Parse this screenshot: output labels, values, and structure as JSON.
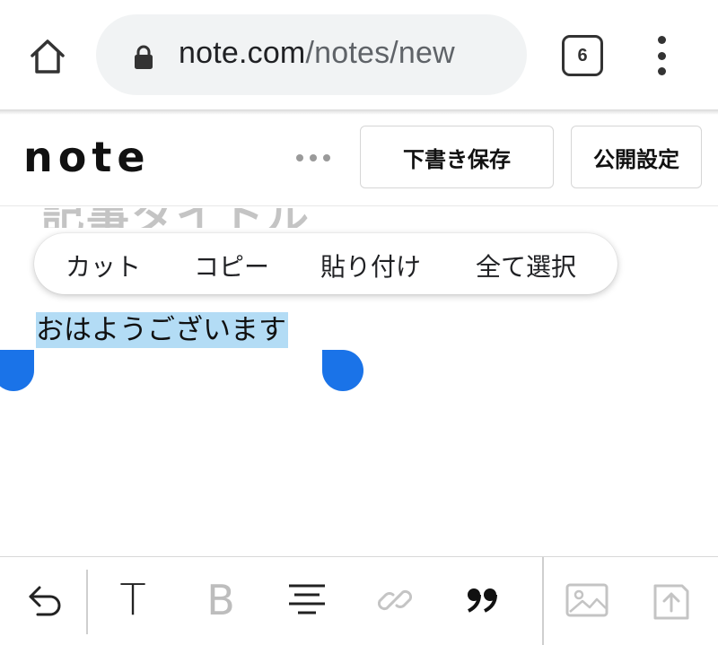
{
  "browser": {
    "url_host": "note.com",
    "url_path": "/notes/new",
    "tab_count": "6",
    "icons": [
      "home-icon",
      "lock-icon",
      "tabs-icon",
      "overflow-menu-icon"
    ]
  },
  "header": {
    "logo": "note",
    "draft_save_label": "下書き保存",
    "publish_settings_label": "公開設定"
  },
  "editor": {
    "title_placeholder": "記事タイトル",
    "body_text": "おはようございます"
  },
  "context_menu": {
    "cut": "カット",
    "copy": "コピー",
    "paste": "貼り付け",
    "select_all": "全て選択"
  },
  "toolbar": {
    "heading_label": "T",
    "bold_label": "B",
    "icons": [
      "undo-icon",
      "heading-icon",
      "bold-icon",
      "align-icon",
      "link-icon",
      "quote-icon",
      "image-icon",
      "upload-icon"
    ]
  },
  "colors": {
    "selection": "#b3dcf5",
    "handle": "#1a73e8",
    "url_pill": "#f1f3f4"
  }
}
